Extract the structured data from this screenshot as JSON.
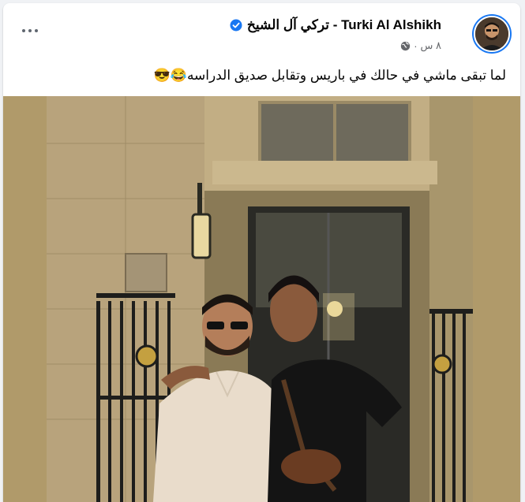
{
  "post": {
    "author_name": "Turki Al Alshikh - تركي آل الشيخ",
    "verified_icon": "verified-badge-icon",
    "timestamp": "٨ س",
    "separator": "·",
    "audience_icon": "globe-icon",
    "text": "لما تبقى ماشي في حالك في باريس وتقابل صديق الدراسه😂😎",
    "more_icon": "more-options-icon",
    "avatar_icon": "profile-avatar",
    "photo_icon": "post-photo"
  },
  "colors": {
    "verified": "#1877f2",
    "text": "#050505",
    "meta": "#65676b",
    "photo_frame": "#b09a6a"
  }
}
